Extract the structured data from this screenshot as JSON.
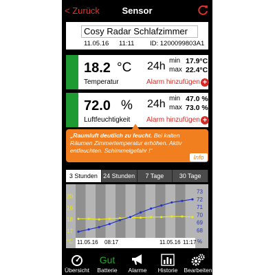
{
  "nav": {
    "back_label": "< Zurück",
    "title": "Sensor"
  },
  "sensor": {
    "name": "Cosy Radar Schlafzimmer",
    "date": "11.05.16",
    "time": "11:11",
    "id": "ID: 1200099803A1"
  },
  "temperature": {
    "value": "18.2",
    "unit": "°C",
    "label": "Temperatur",
    "period": "24h",
    "min_label": "min",
    "max_label": "max",
    "min": "17.9°C",
    "max": "22.4°C",
    "alarm_label": "Alarm hinzufügen",
    "status_color": "#1e9a32"
  },
  "humidity": {
    "value": "72.0",
    "unit": "%",
    "label": "Luftfeuchtigkeit",
    "period": "24h",
    "min_label": "min",
    "max_label": "max",
    "min": "47.0 %",
    "max": "73.0 %",
    "alarm_label": "Alarm hinzufügen",
    "status_color": "#1e9a32"
  },
  "advice": {
    "strong": "„Raumluft deutlich zu feucht.",
    "text": "Bei kalten Räumen Zimmertemperatur erhöhen. Aktiv entfeuchten. Schimmelgefahr !“",
    "info_label": "Info"
  },
  "range_tabs": [
    {
      "label": "3 Stunden",
      "active": true
    },
    {
      "label": "24 Stunden",
      "active": false
    },
    {
      "label": "7 Tage",
      "active": false
    },
    {
      "label": "30 Tage",
      "active": false
    }
  ],
  "chart_data": {
    "type": "line",
    "y_left_ticks": [
      "20",
      "19",
      "18",
      "17"
    ],
    "y_left_unit": "°C",
    "y_left_range": [
      16.4,
      20.8
    ],
    "y_right_ticks": [
      "73",
      "72",
      "71",
      "70",
      "69",
      "68"
    ],
    "y_right_unit": "%",
    "y_right_range": [
      67,
      73.6
    ],
    "x_labels": {
      "start_date": "11.05.16",
      "start_time": "08:17",
      "end_date": "11.05.16",
      "end_time": "11:17"
    },
    "series": [
      {
        "axis": "left",
        "color": "#e8e81a",
        "values": [
          18.05,
          18.05,
          18.0,
          18.05,
          18.1,
          18.15,
          18.15,
          18.2,
          18.2,
          18.25,
          18.25,
          18.2
        ]
      },
      {
        "axis": "right",
        "color": "#2030c8",
        "values": [
          67.8,
          68.1,
          68.4,
          68.8,
          69.3,
          69.7,
          70.3,
          70.8,
          71.2,
          71.6,
          71.8,
          72.0
        ]
      }
    ]
  },
  "tabbar": [
    {
      "label": "Übersicht",
      "icon": "gauge-icon"
    },
    {
      "label": "Batterie",
      "icon": "battery-status-text",
      "status": "Gut"
    },
    {
      "label": "Alarme",
      "icon": "megaphone-icon"
    },
    {
      "label": "Historie",
      "icon": "bar-chart-icon"
    },
    {
      "label": "Bearbeiten",
      "icon": "gears-icon"
    }
  ]
}
